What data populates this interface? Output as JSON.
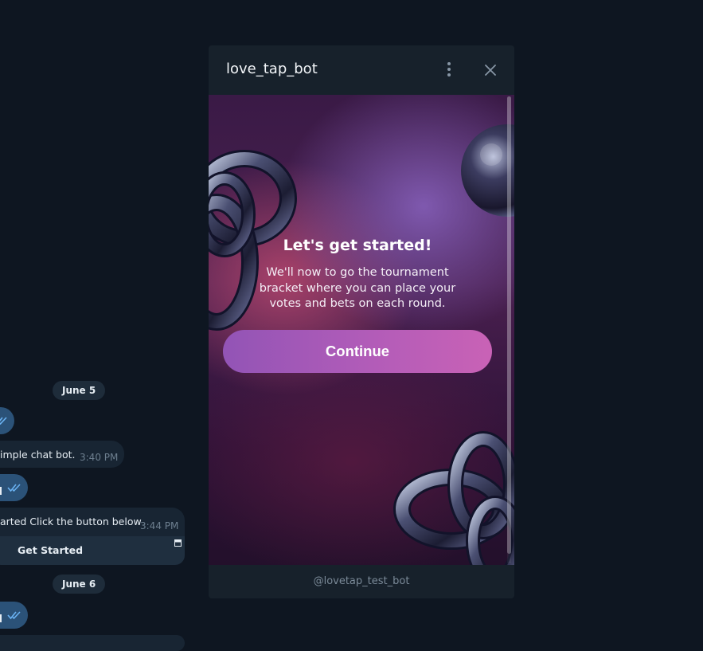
{
  "chat": {
    "dates": [
      "June 5",
      "June 6"
    ],
    "messages": [
      {
        "text": "imple chat bot.",
        "time": "3:40 PM"
      },
      {
        "text": "arted Click the button below",
        "time": "3:44 PM"
      }
    ],
    "inline_button": "Get Started"
  },
  "panel": {
    "title": "love_tap_bot",
    "menu_icon": "more-vertical-icon",
    "close_icon": "close-icon",
    "footer": "@lovetap_test_bot"
  },
  "webapp": {
    "heading": "Let's get started!",
    "description": "We'll now to go the tournament bracket where you can place your votes and bets on each round.",
    "button_label": "Continue"
  },
  "colors": {
    "background": "#0e1621",
    "panel": "#17212b",
    "outgoing_bubble": "#2b5278",
    "incoming_bubble": "#182533",
    "button_gradient_start": "#9254b6",
    "button_gradient_end": "#c962b6"
  }
}
